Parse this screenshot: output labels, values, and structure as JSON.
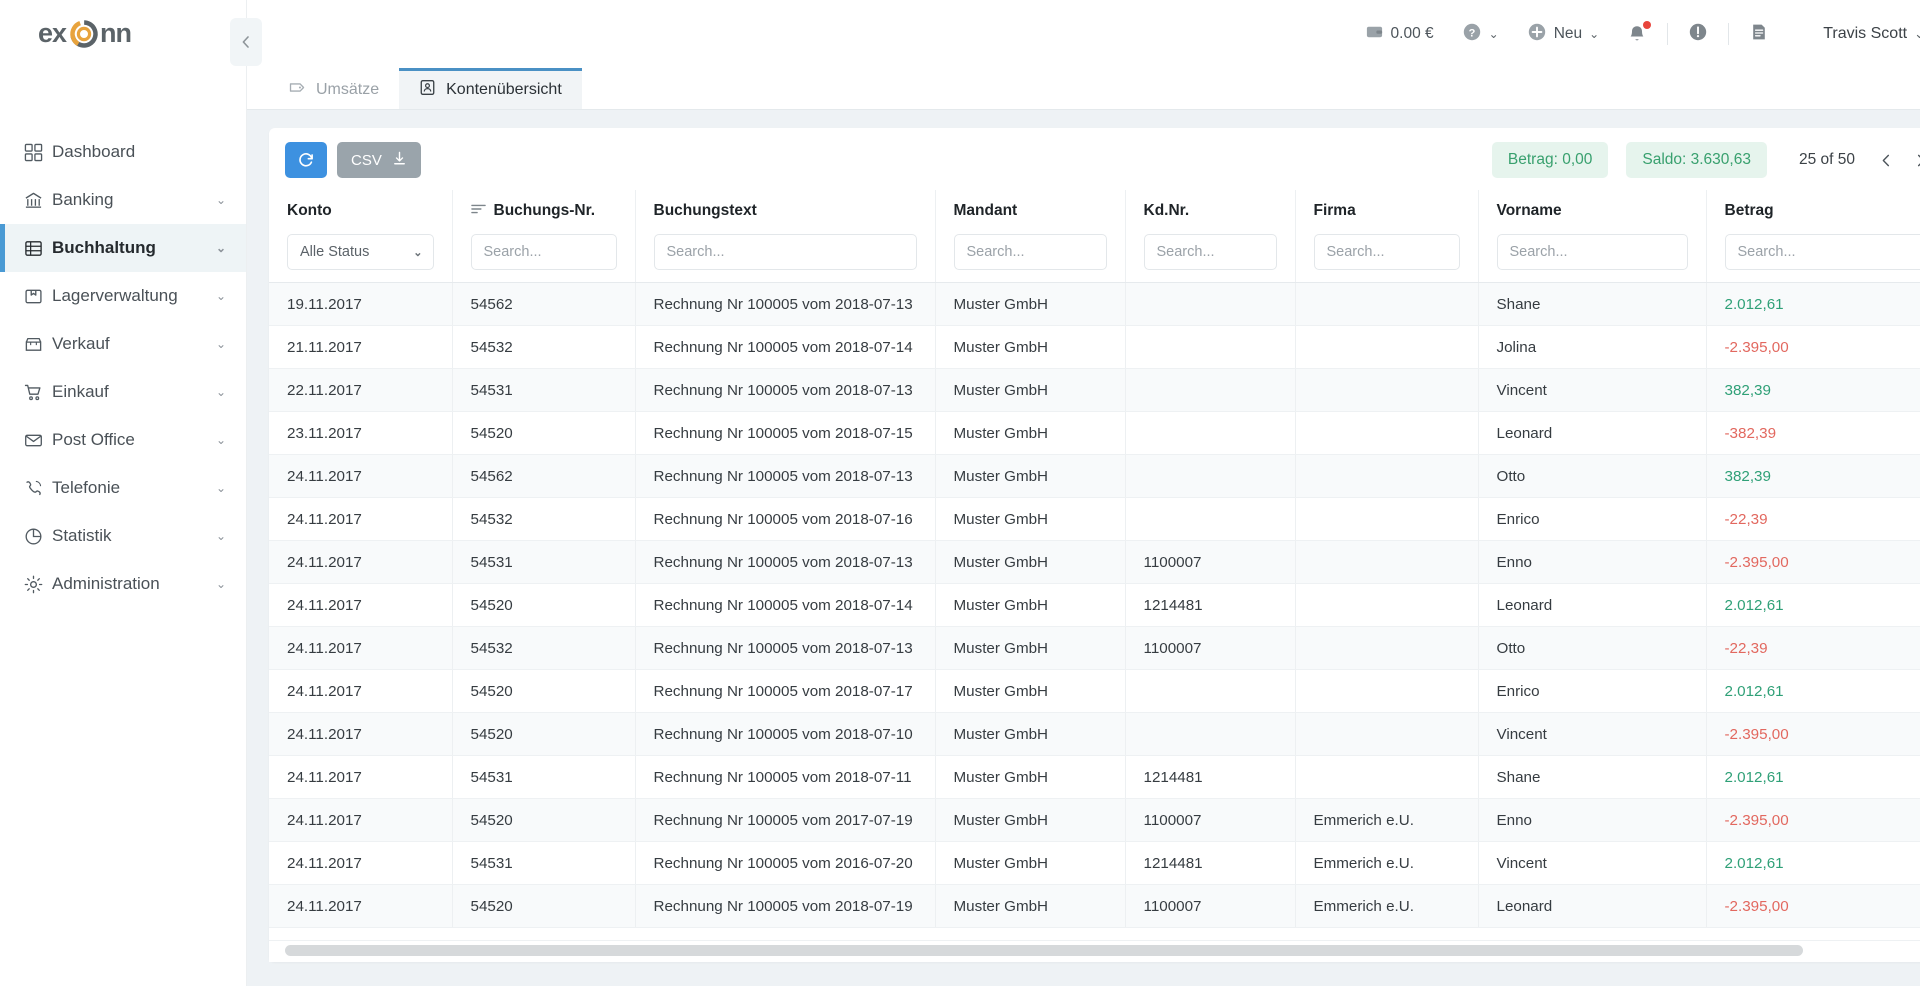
{
  "brand": {
    "name": "exonn",
    "accent": "#e8a33d",
    "dark": "#5b6368"
  },
  "sidebar": {
    "collapse_icon": "chevron-left-icon",
    "items": [
      {
        "label": "Dashboard",
        "icon": "grid-icon",
        "chevron": "",
        "active": false
      },
      {
        "label": "Banking",
        "icon": "bank-icon",
        "chevron": "⌄",
        "active": false
      },
      {
        "label": "Buchhaltung",
        "icon": "ledger-icon",
        "chevron": "⌄",
        "active": true
      },
      {
        "label": "Lagerverwaltung",
        "icon": "box-icon",
        "chevron": "⌄",
        "active": false
      },
      {
        "label": "Verkauf",
        "icon": "store-icon",
        "chevron": "⌄",
        "active": false
      },
      {
        "label": "Einkauf",
        "icon": "cart-icon",
        "chevron": "⌄",
        "active": false
      },
      {
        "label": "Post Office",
        "icon": "envelope-icon",
        "chevron": "⌄",
        "active": false
      },
      {
        "label": "Telefonie",
        "icon": "phone-icon",
        "chevron": "⌄",
        "active": false
      },
      {
        "label": "Statistik",
        "icon": "piechart-icon",
        "chevron": "⌄",
        "active": false
      },
      {
        "label": "Administration",
        "icon": "gear-icon",
        "chevron": "⌄",
        "active": false
      }
    ]
  },
  "topbar": {
    "wallet_amount": "0.00 €",
    "wallet_icon": "wallet-icon",
    "help_icon": "help-circle-icon",
    "new_label": "Neu",
    "new_icon": "plus-circle-icon",
    "bell_icon": "bell-icon",
    "alert_icon": "alert-circle-icon",
    "notes_icon": "document-icon",
    "user_name": "Travis Scott",
    "chevron": "⌄"
  },
  "tabs": [
    {
      "label": "Umsätze",
      "icon": "tag-icon",
      "active": false
    },
    {
      "label": "Kontenübersicht",
      "icon": "contact-card-icon",
      "active": true
    }
  ],
  "toolbar": {
    "refresh_icon": "refresh-icon",
    "csv_label": "CSV",
    "csv_icon": "download-icon",
    "betrag_pill": "Betrag: 0,00",
    "saldo_pill": "Saldo: 3.630,63",
    "pagination_label": "25 of 50",
    "prev_icon": "chevron-left-icon",
    "next_icon": "chevron-right-icon",
    "pill_color": "#38a06e",
    "pill_bg": "#e6f4ed"
  },
  "table": {
    "columns": [
      {
        "key": "konto",
        "label": "Konto",
        "filter_type": "select",
        "filter_value": "Alle Status",
        "sort_icon": false
      },
      {
        "key": "buchungsnr",
        "label": "Buchungs-Nr.",
        "filter_type": "search",
        "placeholder": "Search...",
        "sort_icon": true
      },
      {
        "key": "buchungstext",
        "label": "Buchungstext",
        "filter_type": "search",
        "placeholder": "Search...",
        "sort_icon": false
      },
      {
        "key": "mandant",
        "label": "Mandant",
        "filter_type": "search",
        "placeholder": "Search...",
        "sort_icon": false
      },
      {
        "key": "kdnr",
        "label": "Kd.Nr.",
        "filter_type": "search",
        "placeholder": "Search...",
        "sort_icon": false
      },
      {
        "key": "firma",
        "label": "Firma",
        "filter_type": "search",
        "placeholder": "Search...",
        "sort_icon": false
      },
      {
        "key": "vorname",
        "label": "Vorname",
        "filter_type": "search",
        "placeholder": "Search...",
        "sort_icon": false
      },
      {
        "key": "betrag",
        "label": "Betrag",
        "filter_type": "search",
        "placeholder": "Search...",
        "sort_icon": false
      }
    ],
    "select_options": [
      "Alle Status"
    ],
    "rows": [
      {
        "konto": "19.11.2017",
        "buchungsnr": "54562",
        "buchungstext": "Rechnung Nr 100005 vom 2018-07-13",
        "mandant": "Muster GmbH",
        "kdnr": "",
        "firma": "",
        "vorname": "Shane",
        "betrag": "2.012,61",
        "sign": "pos"
      },
      {
        "konto": "21.11.2017",
        "buchungsnr": "54532",
        "buchungstext": "Rechnung Nr 100005 vom 2018-07-14",
        "mandant": "Muster GmbH",
        "kdnr": "",
        "firma": "",
        "vorname": "Jolina",
        "betrag": "-2.395,00",
        "sign": "neg"
      },
      {
        "konto": "22.11.2017",
        "buchungsnr": "54531",
        "buchungstext": "Rechnung Nr 100005 vom 2018-07-13",
        "mandant": "Muster GmbH",
        "kdnr": "",
        "firma": "",
        "vorname": "Vincent",
        "betrag": "382,39",
        "sign": "pos"
      },
      {
        "konto": "23.11.2017",
        "buchungsnr": "54520",
        "buchungstext": "Rechnung Nr 100005 vom 2018-07-15",
        "mandant": "Muster GmbH",
        "kdnr": "",
        "firma": "",
        "vorname": "Leonard",
        "betrag": "-382,39",
        "sign": "neg"
      },
      {
        "konto": "24.11.2017",
        "buchungsnr": "54562",
        "buchungstext": "Rechnung Nr 100005 vom 2018-07-13",
        "mandant": "Muster GmbH",
        "kdnr": "",
        "firma": "",
        "vorname": "Otto",
        "betrag": "382,39",
        "sign": "pos"
      },
      {
        "konto": "24.11.2017",
        "buchungsnr": "54532",
        "buchungstext": "Rechnung Nr 100005 vom 2018-07-16",
        "mandant": "Muster GmbH",
        "kdnr": "",
        "firma": "",
        "vorname": "Enrico",
        "betrag": "-22,39",
        "sign": "neg"
      },
      {
        "konto": "24.11.2017",
        "buchungsnr": "54531",
        "buchungstext": "Rechnung Nr 100005 vom 2018-07-13",
        "mandant": "Muster GmbH",
        "kdnr": "1100007",
        "firma": "",
        "vorname": "Enno",
        "betrag": "-2.395,00",
        "sign": "neg"
      },
      {
        "konto": "24.11.2017",
        "buchungsnr": "54520",
        "buchungstext": "Rechnung Nr 100005 vom 2018-07-14",
        "mandant": "Muster GmbH",
        "kdnr": "1214481",
        "firma": "",
        "vorname": "Leonard",
        "betrag": "2.012,61",
        "sign": "pos"
      },
      {
        "konto": "24.11.2017",
        "buchungsnr": "54532",
        "buchungstext": "Rechnung Nr 100005 vom 2018-07-13",
        "mandant": "Muster GmbH",
        "kdnr": "1100007",
        "firma": "",
        "vorname": "Otto",
        "betrag": "-22,39",
        "sign": "neg"
      },
      {
        "konto": "24.11.2017",
        "buchungsnr": "54520",
        "buchungstext": "Rechnung Nr 100005 vom 2018-07-17",
        "mandant": "Muster GmbH",
        "kdnr": "",
        "firma": "",
        "vorname": "Enrico",
        "betrag": "2.012,61",
        "sign": "pos"
      },
      {
        "konto": "24.11.2017",
        "buchungsnr": "54520",
        "buchungstext": "Rechnung Nr 100005 vom 2018-07-10",
        "mandant": "Muster GmbH",
        "kdnr": "",
        "firma": "",
        "vorname": "Vincent",
        "betrag": "-2.395,00",
        "sign": "neg"
      },
      {
        "konto": "24.11.2017",
        "buchungsnr": "54531",
        "buchungstext": "Rechnung Nr 100005 vom 2018-07-11",
        "mandant": "Muster GmbH",
        "kdnr": "1214481",
        "firma": "",
        "vorname": "Shane",
        "betrag": "2.012,61",
        "sign": "pos"
      },
      {
        "konto": "24.11.2017",
        "buchungsnr": "54520",
        "buchungstext": "Rechnung Nr 100005 vom 2017-07-19",
        "mandant": "Muster GmbH",
        "kdnr": "1100007",
        "firma": "Emmerich e.U.",
        "vorname": "Enno",
        "betrag": "-2.395,00",
        "sign": "neg"
      },
      {
        "konto": "24.11.2017",
        "buchungsnr": "54531",
        "buchungstext": "Rechnung Nr 100005 vom 2016-07-20",
        "mandant": "Muster GmbH",
        "kdnr": "1214481",
        "firma": "Emmerich e.U.",
        "vorname": "Vincent",
        "betrag": "2.012,61",
        "sign": "pos"
      },
      {
        "konto": "24.11.2017",
        "buchungsnr": "54520",
        "buchungstext": "Rechnung Nr 100005 vom 2018-07-19",
        "mandant": "Muster GmbH",
        "kdnr": "1100007",
        "firma": "Emmerich e.U.",
        "vorname": "Leonard",
        "betrag": "-2.395,00",
        "sign": "neg"
      }
    ]
  }
}
